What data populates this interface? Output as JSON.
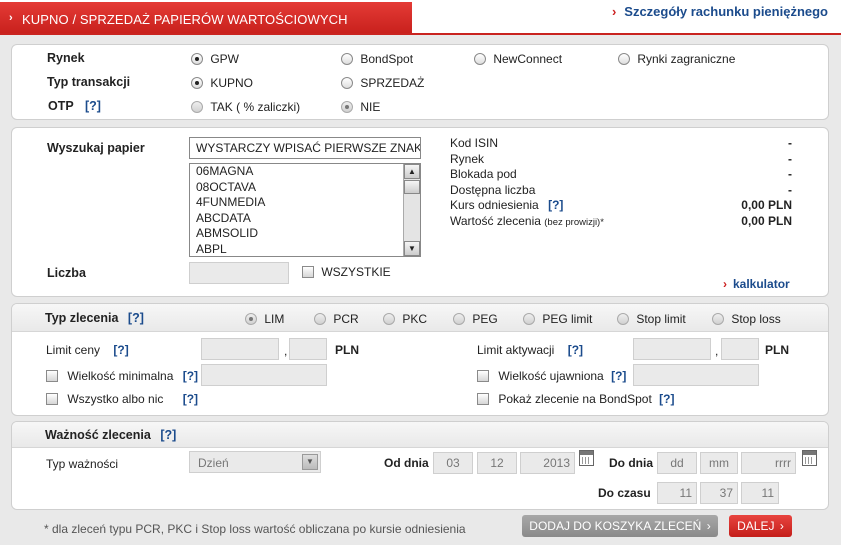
{
  "header": {
    "tab_title": "KUPNO / SPRZEDAŻ PAPIERÓW WARTOŚCIOWYCH",
    "account_link": "Szczegóły rachunku pieniężnego"
  },
  "market": {
    "label": "Rynek",
    "options": [
      "GPW",
      "BondSpot",
      "NewConnect",
      "Rynki zagraniczne"
    ],
    "selected": "GPW"
  },
  "transaction": {
    "label": "Typ transakcji",
    "options": [
      "KUPNO",
      "SPRZEDAŻ"
    ],
    "selected": "KUPNO"
  },
  "otp": {
    "label": "OTP",
    "help": "[?]",
    "option_yes": "TAK (  % zaliczki)",
    "option_no": "NIE",
    "selected": "NIE"
  },
  "search": {
    "label": "Wyszukaj papier",
    "value": "WYSTARCZY WPISAĆ PIERWSZE ZNAKI",
    "list": [
      "06MAGNA",
      "08OCTAVA",
      "4FUNMEDIA",
      "ABCDATA",
      "ABMSOLID",
      "ABPL"
    ]
  },
  "quantity": {
    "label": "Liczba",
    "all_label": "WSZYSTKIE"
  },
  "info": {
    "isin_label": "Kod ISIN",
    "isin_value": "-",
    "market_label": "Rynek",
    "market_value": "-",
    "lock_label": "Blokada pod",
    "lock_value": "-",
    "available_label": "Dostępna liczba",
    "available_value": "-",
    "ref_label": "Kurs odniesienia",
    "ref_help": "[?]",
    "ref_value": "0,00 PLN",
    "order_value_label": "Wartość zlecenia",
    "order_value_note": "(bez prowizji)*",
    "order_value": "0,00 PLN"
  },
  "calculator_link": "kalkulator",
  "order_type": {
    "label": "Typ zlecenia",
    "help": "[?]",
    "options": [
      "LIM",
      "PCR",
      "PKC",
      "PEG",
      "PEG limit",
      "Stop limit",
      "Stop loss"
    ],
    "selected": "LIM"
  },
  "limits": {
    "price_label": "Limit ceny",
    "price_help": "[?]",
    "price_currency": "PLN",
    "activation_label": "Limit aktywacji",
    "activation_help": "[?]",
    "activation_currency": "PLN",
    "sep": ","
  },
  "options": {
    "min_size_label": "Wielkość minimalna",
    "min_size_help": "[?]",
    "all_or_none_label": "Wszystko albo nic",
    "all_or_none_help": "[?]",
    "visible_size_label": "Wielkość ujawniona",
    "visible_size_help": "[?]",
    "show_bondspot_label": "Pokaż zlecenie na BondSpot",
    "show_bondspot_help": "[?]"
  },
  "validity": {
    "label": "Ważność zlecenia",
    "help": "[?]",
    "type_label": "Typ ważności",
    "type_value": "Dzień",
    "from_label": "Od dnia",
    "from_dd": "03",
    "from_mm": "12",
    "from_yyyy": "2013",
    "to_label": "Do dnia",
    "to_dd": "dd",
    "to_mm": "mm",
    "to_yyyy": "rrrr",
    "time_label": "Do czasu",
    "time_h": "11",
    "time_m": "37",
    "time_s": "11"
  },
  "footer": {
    "note": "* dla zleceń typu PCR, PKC i Stop loss wartość obliczana po kursie odniesienia",
    "add_button": "DODAJ DO KOSZYKA ZLECEŃ",
    "next_button": "DALEJ"
  }
}
